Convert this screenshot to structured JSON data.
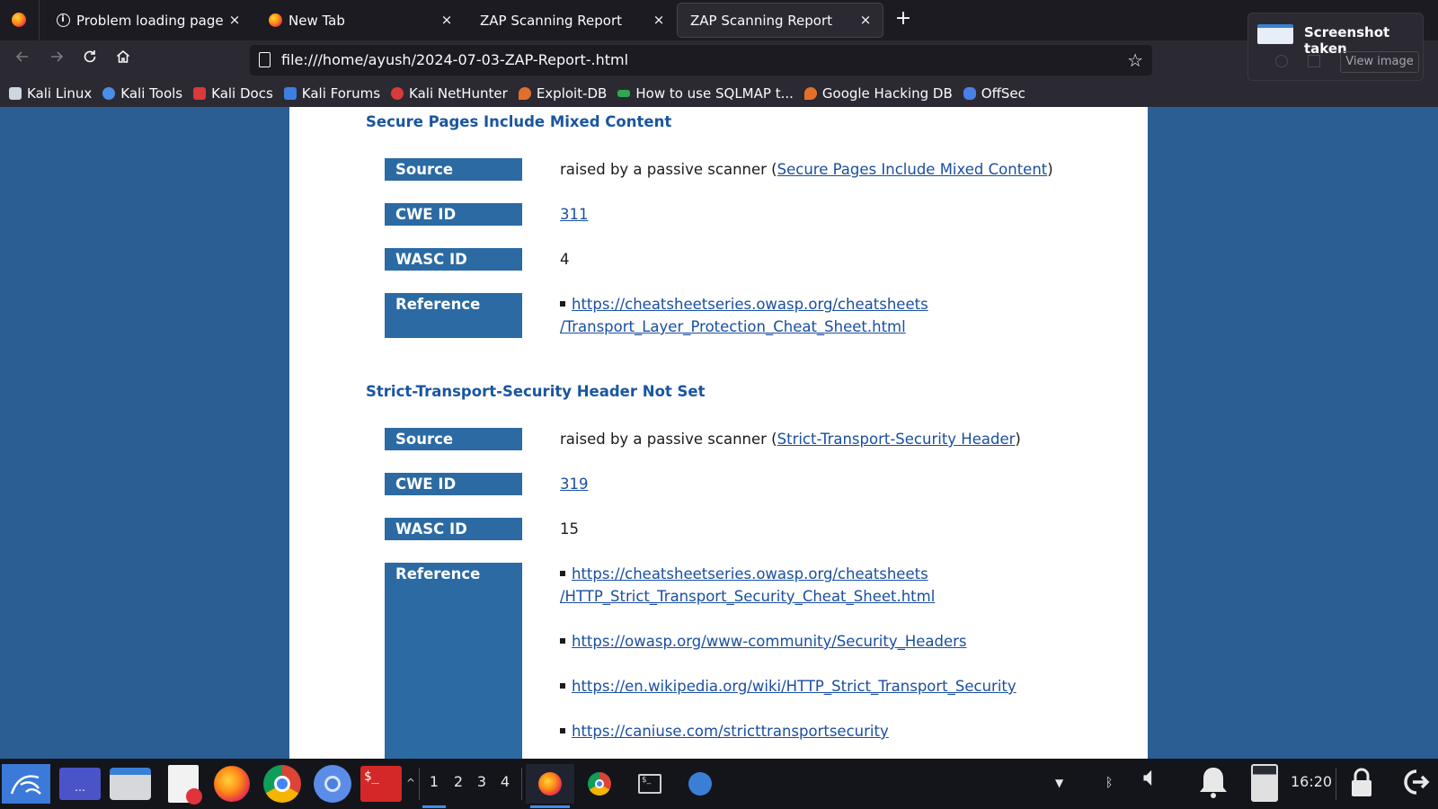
{
  "tabs": [
    {
      "label": "Problem loading page",
      "icon": "info-icon",
      "active": false
    },
    {
      "label": "New Tab",
      "icon": "firefox-icon",
      "active": false
    },
    {
      "label": "ZAP Scanning Report",
      "icon": "",
      "active": false
    },
    {
      "label": "ZAP Scanning Report",
      "icon": "",
      "active": true
    }
  ],
  "tab_close_glyph": "×",
  "new_tab_glyph": "+",
  "nav": {
    "url": "file:///home/ayush/2024-07-03-ZAP-Report-.html"
  },
  "bookmarks": [
    {
      "label": "Kali Linux",
      "color": "#cfd6e0"
    },
    {
      "label": "Kali Tools",
      "color": "#4a8ee8"
    },
    {
      "label": "Kali Docs",
      "color": "#d93a3a"
    },
    {
      "label": "Kali Forums",
      "color": "#3d7fe0"
    },
    {
      "label": "Kali NetHunter",
      "color": "#d83b3b"
    },
    {
      "label": "Exploit-DB",
      "color": "#e3702a"
    },
    {
      "label": "How to use SQLMAP t...",
      "color": "#2ea84f"
    },
    {
      "label": "Google Hacking DB",
      "color": "#e3702a"
    },
    {
      "label": "OffSec",
      "color": "#4a7fe8"
    }
  ],
  "report": {
    "alerts": [
      {
        "title": "Secure Pages Include Mixed Content",
        "labels": {
          "source": "Source",
          "cwe": "CWE ID",
          "wasc": "WASC ID",
          "reference": "Reference"
        },
        "source_prefix": "raised by a passive scanner (",
        "source_link": "Secure Pages Include Mixed Content",
        "source_suffix": ")",
        "cwe_id": "311",
        "wasc_id": "4",
        "references": [
          {
            "line1": "https://cheatsheetseries.owasp.org/cheatsheets",
            "line2": "/Transport_Layer_Protection_Cheat_Sheet.html"
          }
        ]
      },
      {
        "title": "Strict-Transport-Security Header Not Set",
        "labels": {
          "source": "Source",
          "cwe": "CWE ID",
          "wasc": "WASC ID",
          "reference": "Reference"
        },
        "source_prefix": "raised by a passive scanner (",
        "source_link": "Strict-Transport-Security Header",
        "source_suffix": ")",
        "cwe_id": "319",
        "wasc_id": "15",
        "references": [
          {
            "line1": "https://cheatsheetseries.owasp.org/cheatsheets",
            "line2": "/HTTP_Strict_Transport_Security_Cheat_Sheet.html"
          },
          {
            "line1": "https://owasp.org/www-community/Security_Headers"
          },
          {
            "line1": "https://en.wikipedia.org/wiki/HTTP_Strict_Transport_Security"
          },
          {
            "line1": "https://caniuse.com/stricttransportsecurity"
          }
        ]
      }
    ]
  },
  "notification": {
    "title": "Screenshot taken",
    "button": "View image"
  },
  "taskbar": {
    "workspaces": [
      "1",
      "2",
      "3",
      "4"
    ],
    "active_workspace": 0,
    "clock": "16:20",
    "terminal_label": "$_"
  }
}
